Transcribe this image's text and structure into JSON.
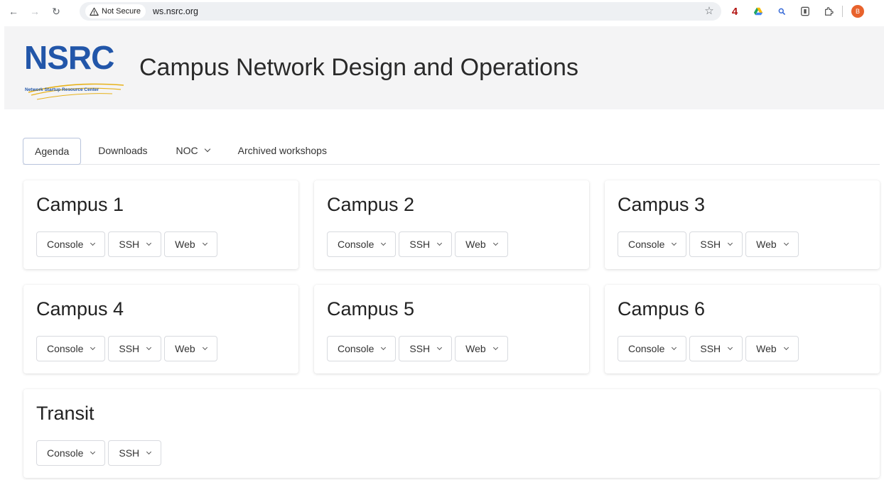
{
  "browser": {
    "security_label": "Not Secure",
    "url": "ws.nsrc.org",
    "extension_badge": "4",
    "profile_initial": "B"
  },
  "site": {
    "logo_text": "NSRC",
    "logo_subtitle": "Network Startup Resource Center",
    "title": "Campus Network Design and Operations"
  },
  "tabs": [
    {
      "label": "Agenda",
      "active": true
    },
    {
      "label": "Downloads",
      "active": false
    },
    {
      "label": "NOC",
      "active": false,
      "dropdown": true
    },
    {
      "label": "Archived workshops",
      "active": false
    }
  ],
  "cards": [
    {
      "title": "Campus 1",
      "buttons": [
        "Console",
        "SSH",
        "Web"
      ]
    },
    {
      "title": "Campus 2",
      "buttons": [
        "Console",
        "SSH",
        "Web"
      ]
    },
    {
      "title": "Campus 3",
      "buttons": [
        "Console",
        "SSH",
        "Web"
      ]
    },
    {
      "title": "Campus 4",
      "buttons": [
        "Console",
        "SSH",
        "Web"
      ]
    },
    {
      "title": "Campus 5",
      "buttons": [
        "Console",
        "SSH",
        "Web"
      ]
    },
    {
      "title": "Campus 6",
      "buttons": [
        "Console",
        "SSH",
        "Web"
      ]
    },
    {
      "title": "Transit",
      "buttons": [
        "Console",
        "SSH"
      ]
    }
  ],
  "colors": {
    "brand_blue": "#2256a9",
    "header_bg": "#f4f4f5",
    "avatar": "#e8622c"
  }
}
